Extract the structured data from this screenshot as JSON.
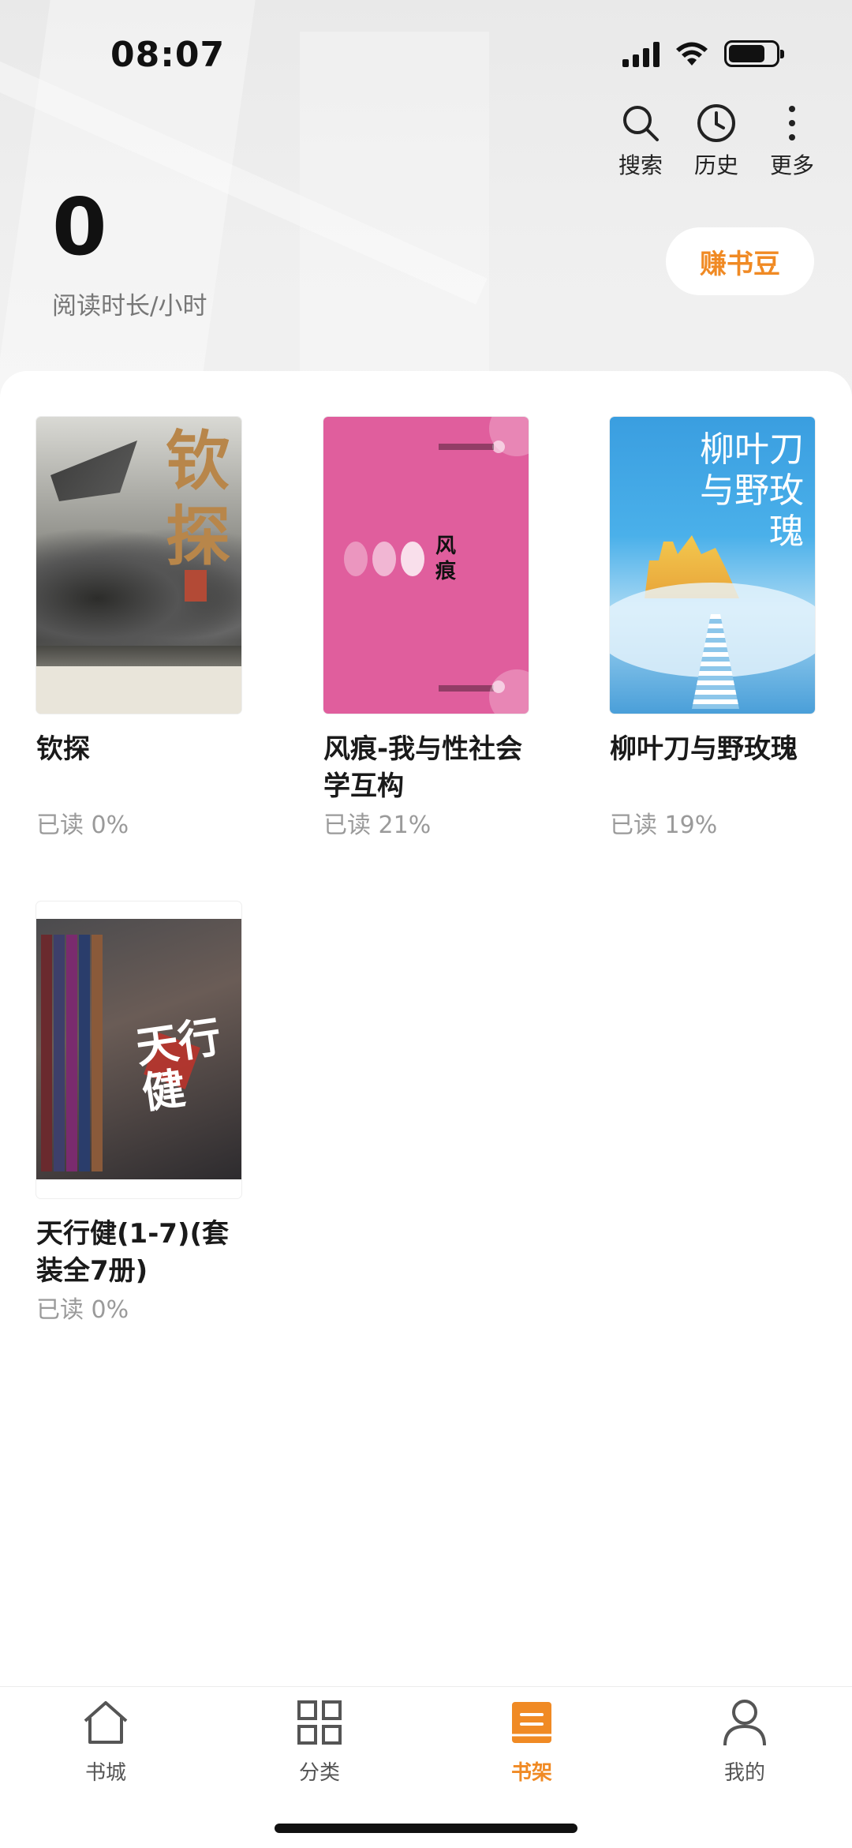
{
  "status_bar": {
    "time": "08:07"
  },
  "header": {
    "actions": [
      {
        "label": "搜索",
        "icon": "search-icon"
      },
      {
        "label": "历史",
        "icon": "history-icon"
      },
      {
        "label": "更多",
        "icon": "more-icon"
      }
    ]
  },
  "reading": {
    "hours": "0",
    "label": "阅读时长/小时",
    "earn_button": "赚书豆"
  },
  "books": [
    {
      "title": "钦探",
      "progress": "已读  0%",
      "cover_text": "钦探"
    },
    {
      "title": "风痕-我与性社会学互构",
      "progress": "已读  21%",
      "cover_text": "风痕"
    },
    {
      "title": "柳叶刀与野玫瑰",
      "progress": "已读  19%",
      "cover_text": "柳叶刀与野玫瑰"
    },
    {
      "title": "天行健(1-7)(套装全7册)",
      "progress": "已读  0%",
      "cover_text": "天行健"
    }
  ],
  "bottom_nav": [
    {
      "label": "书城",
      "icon": "home-icon",
      "active": false
    },
    {
      "label": "分类",
      "icon": "grid-icon",
      "active": false
    },
    {
      "label": "书架",
      "icon": "bookshelf-icon",
      "active": true
    },
    {
      "label": "我的",
      "icon": "profile-icon",
      "active": false
    }
  ],
  "colors": {
    "accent": "#f08a24",
    "cover_pink": "#e05e9d",
    "cover_blue": "#3a9ee0"
  }
}
